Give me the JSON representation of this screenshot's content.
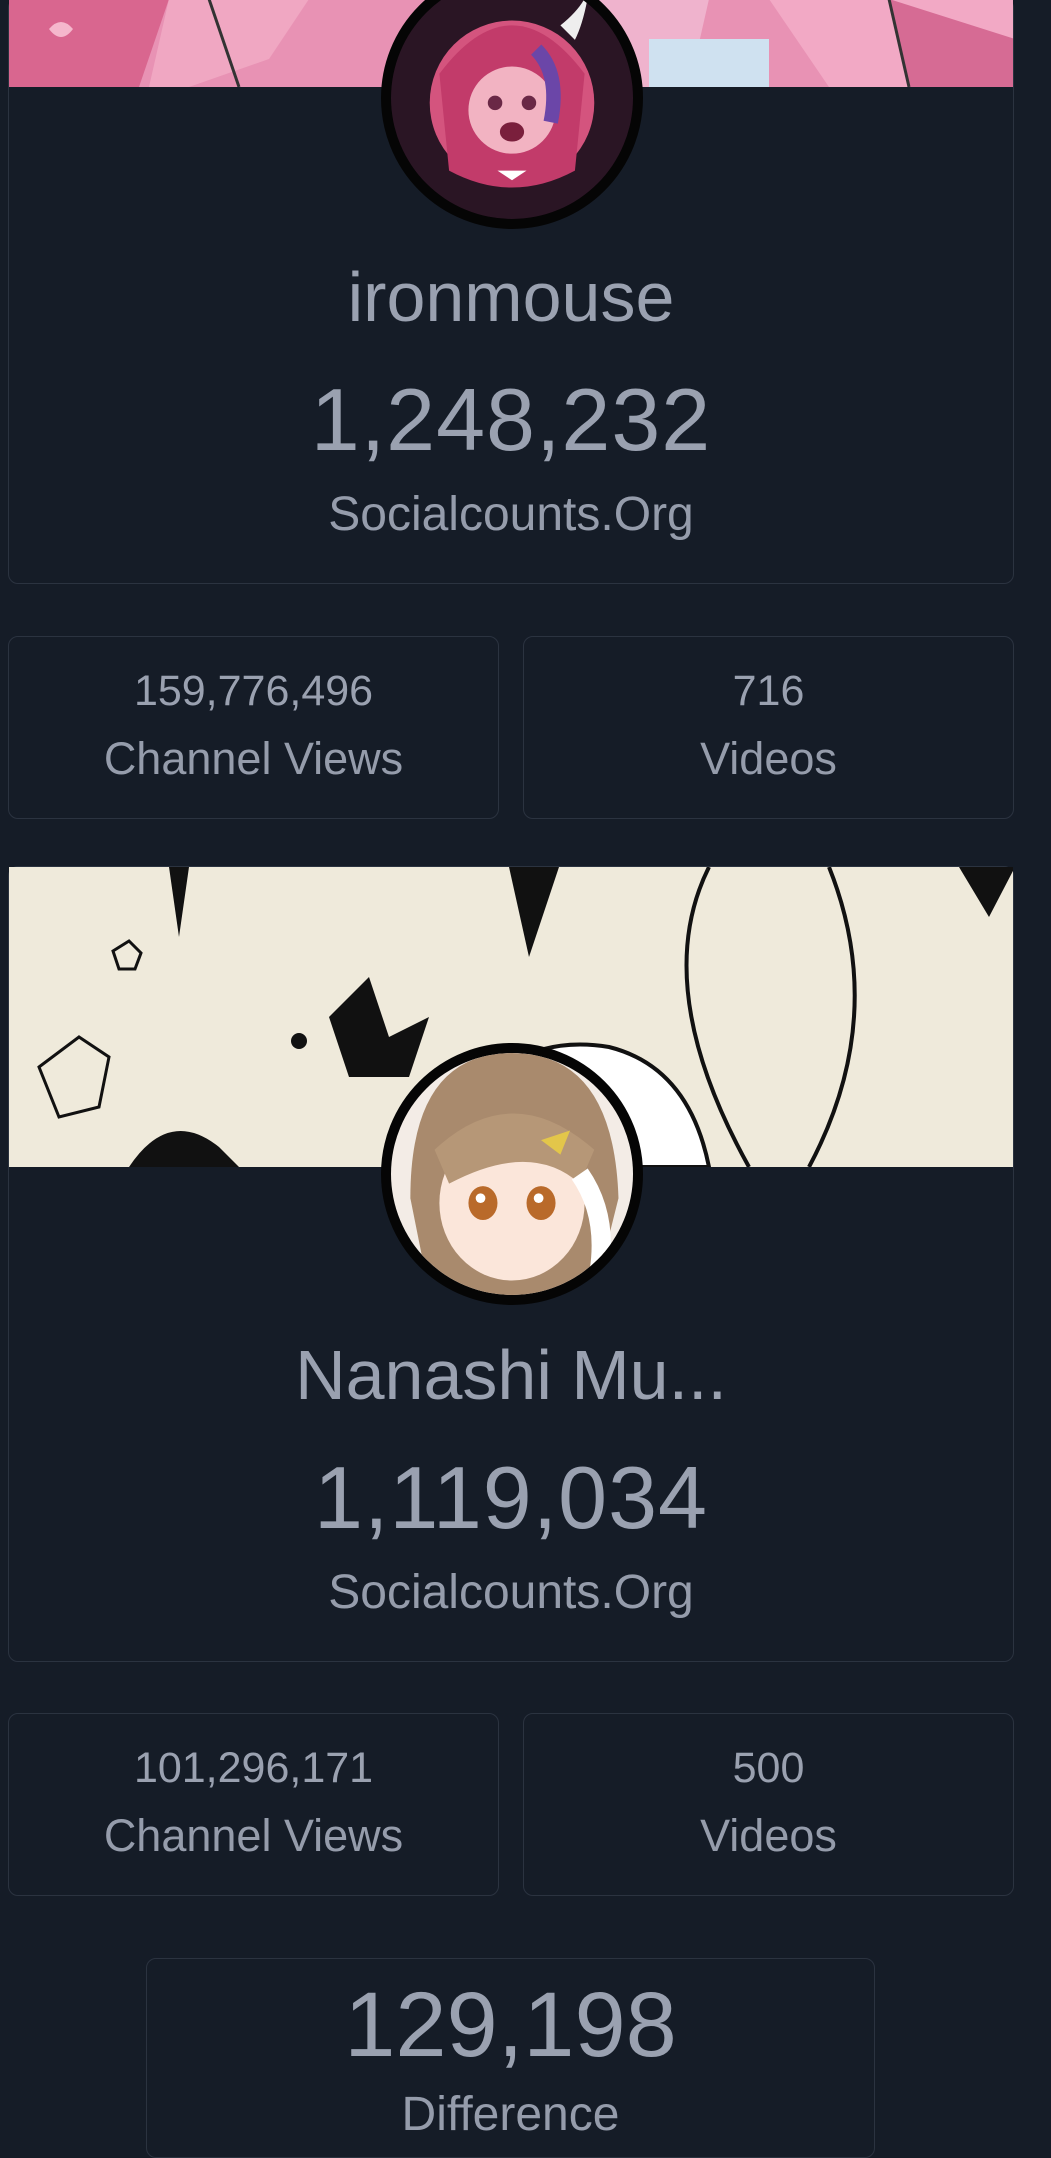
{
  "channels": [
    {
      "name": "ironmouse",
      "subscribers": "1,248,232",
      "source": "Socialcounts.Org",
      "channel_views": "159,776,496",
      "channel_views_label": "Channel Views",
      "videos": "716",
      "videos_label": "Videos"
    },
    {
      "name": "Nanashi Mu...",
      "subscribers": "1,119,034",
      "source": "Socialcounts.Org",
      "channel_views": "101,296,171",
      "channel_views_label": "Channel Views",
      "videos": "500",
      "videos_label": "Videos"
    }
  ],
  "difference": {
    "value": "129,198",
    "label": "Difference"
  },
  "colors": {
    "background": "#151c27",
    "border": "#2b3340",
    "text": "#9aa1b0"
  }
}
